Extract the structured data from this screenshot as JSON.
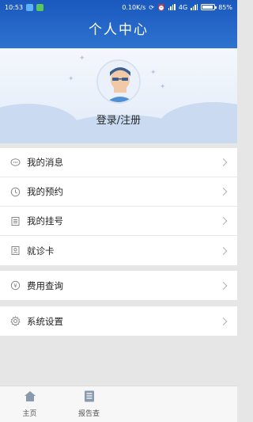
{
  "status_bar": {
    "time": "10:53",
    "speed": "0.10K/s",
    "network": "4G",
    "battery": "85%"
  },
  "header": {
    "title": "个人中心"
  },
  "profile": {
    "login_label": "登录/注册"
  },
  "menu_group1": [
    {
      "label": "我的消息",
      "icon": "message-icon"
    },
    {
      "label": "我的预约",
      "icon": "clock-icon"
    },
    {
      "label": "我的挂号",
      "icon": "document-icon"
    },
    {
      "label": "就诊卡",
      "icon": "card-icon"
    }
  ],
  "menu_group2": [
    {
      "label": "费用查询",
      "icon": "yuan-icon"
    }
  ],
  "menu_group3": [
    {
      "label": "系统设置",
      "icon": "gear-icon"
    }
  ],
  "tabbar": [
    {
      "label": "主页",
      "icon": "home-icon"
    },
    {
      "label": "报告查",
      "icon": "report-icon"
    }
  ],
  "colors": {
    "header": "#2e73d0",
    "background": "#e6e6e6",
    "profile_bg": "#e9f0fa"
  }
}
